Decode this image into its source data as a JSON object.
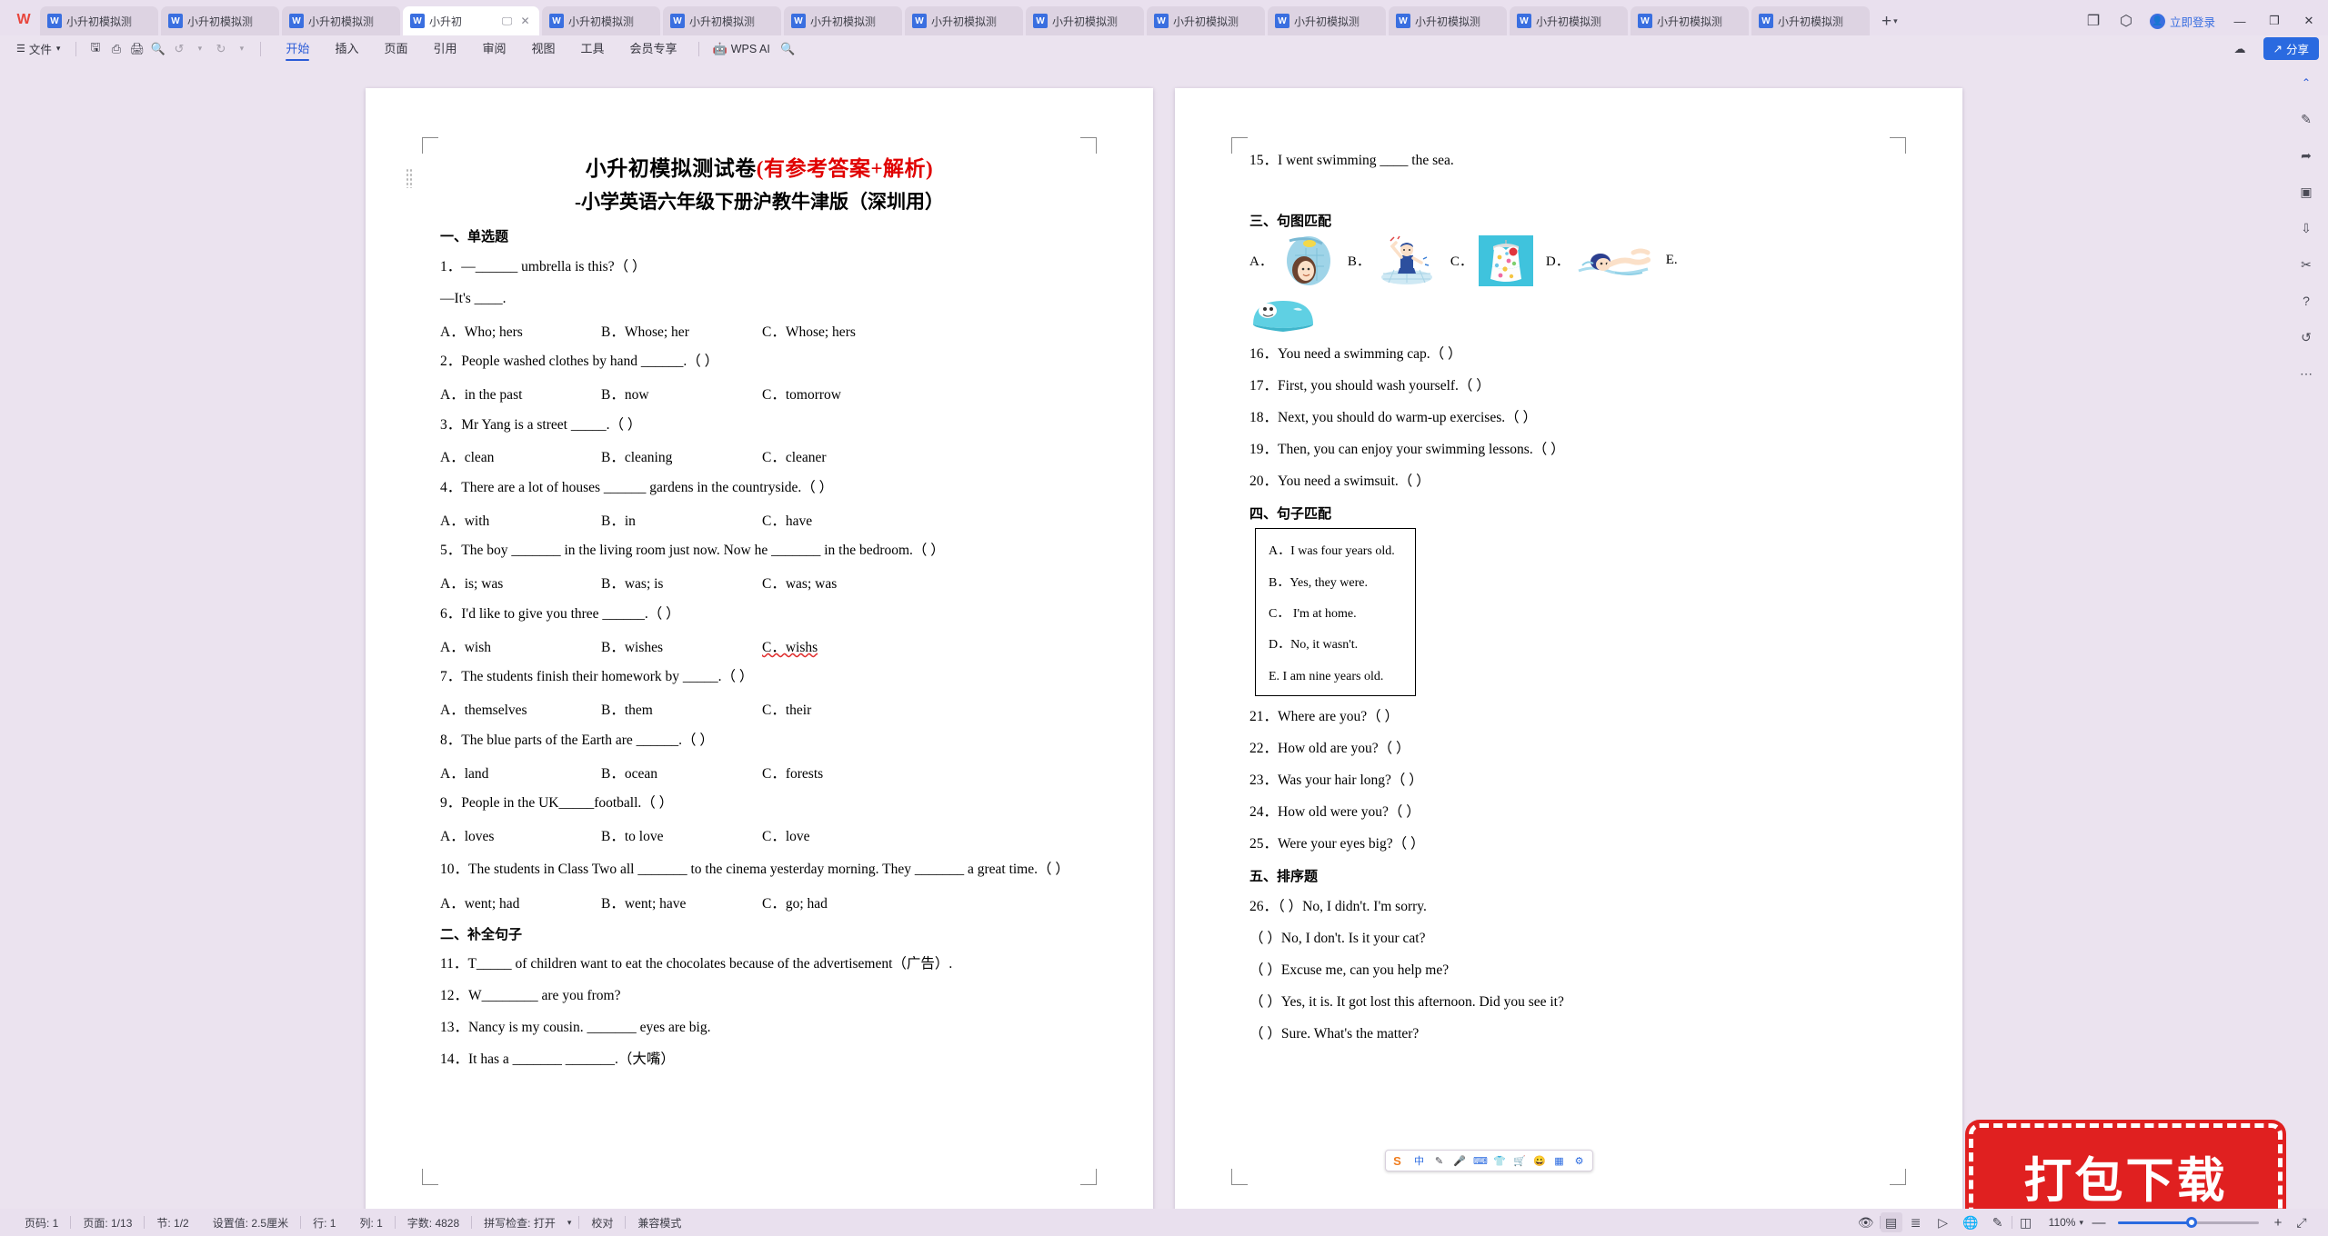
{
  "window": {
    "tabs": [
      {
        "label": "小升初模拟测",
        "active": false
      },
      {
        "label": "小升初模拟测",
        "active": false
      },
      {
        "label": "小升初模拟测",
        "active": false
      },
      {
        "label": "小升初",
        "active": true
      },
      {
        "label": "小升初模拟测",
        "active": false
      },
      {
        "label": "小升初模拟测",
        "active": false
      },
      {
        "label": "小升初模拟测",
        "active": false
      },
      {
        "label": "小升初模拟测",
        "active": false
      },
      {
        "label": "小升初模拟测",
        "active": false
      },
      {
        "label": "小升初模拟测",
        "active": false
      },
      {
        "label": "小升初模拟测",
        "active": false
      },
      {
        "label": "小升初模拟测",
        "active": false
      },
      {
        "label": "小升初模拟测",
        "active": false
      },
      {
        "label": "小升初模拟测",
        "active": false
      },
      {
        "label": "小升初模拟测",
        "active": false
      }
    ],
    "file_icon_letter": "W",
    "logo": "W",
    "new_tab_label": "+",
    "login_label": "立即登录",
    "minimize": "—",
    "maximize": "❐",
    "close": "✕"
  },
  "ribbon": {
    "file_label": "文件",
    "menu": [
      {
        "label": "开始",
        "selected": true
      },
      {
        "label": "插入",
        "selected": false
      },
      {
        "label": "页面",
        "selected": false
      },
      {
        "label": "引用",
        "selected": false
      },
      {
        "label": "审阅",
        "selected": false
      },
      {
        "label": "视图",
        "selected": false
      },
      {
        "label": "工具",
        "selected": false
      },
      {
        "label": "会员专享",
        "selected": false
      }
    ],
    "ai_label": "WPS AI",
    "share_label": "分享"
  },
  "document": {
    "title_black": "小升初模拟测试卷",
    "title_red": "(有参考答案+解析)",
    "subtitle": "-小学英语六年级下册沪教牛津版（深圳用）",
    "section1_heading": "一、单选题",
    "questions_page1": [
      {
        "num": "1．",
        "text": "—______ umbrella is this?（ ）"
      },
      {
        "num": "",
        "text": "—It's ____."
      },
      {
        "opts": [
          "A．Who; hers",
          "B．Whose; her",
          "C．Whose; hers"
        ]
      },
      {
        "num": "2．",
        "text": "People washed clothes by hand ______.（ ）"
      },
      {
        "opts": [
          "A．in the past",
          "B．now",
          "C．tomorrow"
        ]
      },
      {
        "num": "3．",
        "text": "Mr Yang is a street _____.（ ）"
      },
      {
        "opts": [
          "A．clean",
          "B．cleaning",
          "C．cleaner"
        ]
      },
      {
        "num": "4．",
        "text": "There are a lot of houses ______ gardens in the countryside.（ ）"
      },
      {
        "opts": [
          "A．with",
          "B．in",
          "C．have"
        ]
      },
      {
        "num": "5．",
        "text": "The boy _______ in the living room just now. Now he _______ in the bedroom.（  ）"
      },
      {
        "opts": [
          "A．is; was",
          "B．was; is",
          "C．was; was"
        ]
      },
      {
        "num": "6．",
        "text": "I'd like to give you three ______.（ ）"
      },
      {
        "opts": [
          "A．wish",
          "B．wishes",
          "C．wishs"
        ]
      },
      {
        "num": "7．",
        "text": "The students finish their homework by _____.（ ）"
      },
      {
        "opts": [
          "A．themselves",
          "B．them",
          "C．their"
        ]
      },
      {
        "num": "8．",
        "text": "The blue parts of the Earth are ______.（ ）"
      },
      {
        "opts": [
          "A．land",
          "B．ocean",
          "C．forests"
        ]
      },
      {
        "num": "9．",
        "text": "People in the UK_____football.（  ）"
      },
      {
        "opts": [
          "A．loves",
          "B．to love",
          "C．love"
        ]
      },
      {
        "num": "10．",
        "text": "The students in Class Two all _______ to the cinema yesterday morning. They _______ a great time.（  ）"
      },
      {
        "opts": [
          "A．went; had",
          "B．went; have",
          "C．go; had"
        ]
      }
    ],
    "section2_heading": "二、补全句子",
    "fill_questions": [
      {
        "num": "11．",
        "text": "T_____ of children want to eat the chocolates because of the advertisement（广告）."
      },
      {
        "num": "12．",
        "text": "W________ are you from?"
      },
      {
        "num": "13．",
        "text": "Nancy is my cousin. _______ eyes are big."
      },
      {
        "num": "14．",
        "text": "It has a _______ _______.（大嘴）"
      }
    ],
    "q15": {
      "num": "15．",
      "text": "I went swimming ____ the sea."
    },
    "section3_heading": "三、句图匹配",
    "picture_labels": [
      "A．",
      "B．",
      "C．",
      "D．",
      "E."
    ],
    "picture_names": [
      "shower-washing-picture",
      "warm-up-exercise-picture",
      "swimsuit-picture",
      "swimming-picture",
      "swimming-cap-picture"
    ],
    "match_questions": [
      {
        "num": "16．",
        "text": "You need a swimming cap.（    ）"
      },
      {
        "num": "17．",
        "text": "First, you should wash yourself.（    ）"
      },
      {
        "num": "18．",
        "text": "Next, you should do warm-up exercises.（    ）"
      },
      {
        "num": "19．",
        "text": "Then, you can enjoy your swimming lessons.（    ）"
      },
      {
        "num": "20．",
        "text": "You need a swimsuit.（    ）"
      }
    ],
    "section4_heading": "四、句子匹配",
    "match_box_items": [
      "A．I was four years old.",
      "B．Yes, they were.",
      "C． I'm at home.",
      "D．No, it wasn't.",
      "E. I am nine years old."
    ],
    "sentence_questions": [
      {
        "num": "21．",
        "text": "Where are you?（    ）"
      },
      {
        "num": "22．",
        "text": "How old are you?（    ）"
      },
      {
        "num": "23．",
        "text": "Was your hair long?（    ）"
      },
      {
        "num": "24．",
        "text": "How old were you?（    ）"
      },
      {
        "num": "25．",
        "text": "Were your eyes big?（    ）"
      }
    ],
    "section5_heading": "五、排序题",
    "order_questions": [
      {
        "num": "26．",
        "text": "（      ）No, I didn't. I'm sorry."
      },
      {
        "num": "",
        "text": "（      ）No, I don't. Is it your cat?"
      },
      {
        "num": "",
        "text": "（      ）Excuse me, can you help me?"
      },
      {
        "num": "",
        "text": "（      ）Yes, it is. It got lost this afternoon. Did you see it?"
      },
      {
        "num": "",
        "text": "（      ）Sure. What's the matter?"
      }
    ]
  },
  "ime": {
    "mode": "中",
    "items": [
      "中",
      "✎",
      "🎤",
      "⌨",
      "👕",
      "🛒",
      "🎮",
      "⊞",
      "⚙"
    ]
  },
  "watermark": {
    "label": "打包下载"
  },
  "status": {
    "left": [
      "页码: 1",
      "页面: 1/13",
      "节: 1/2",
      "设置值: 2.5厘米",
      "行: 1",
      "列: 1",
      "字数: 4828",
      "拼写检查: 打开",
      "校对",
      "兼容模式"
    ],
    "zoom": "110%",
    "minus": "—",
    "plus": "+"
  },
  "colors": {
    "accent": "#2a6ae0",
    "title_red": "#e00000",
    "chrome": "#ebe3ef",
    "badge_red": "#e02020"
  }
}
